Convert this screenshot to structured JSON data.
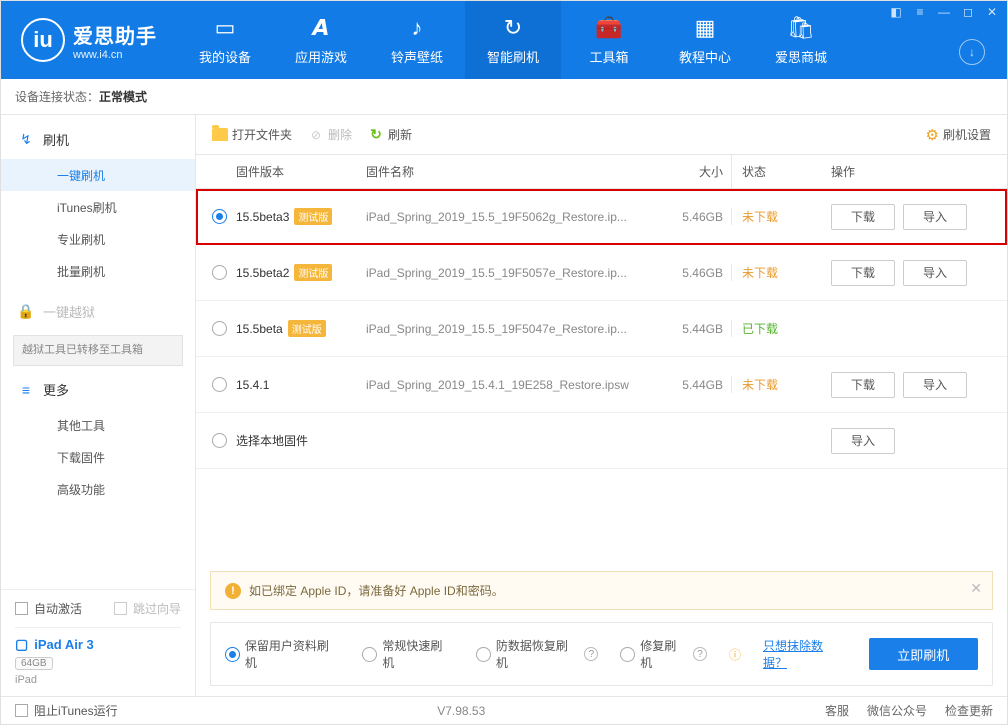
{
  "header": {
    "logo_title": "爱思助手",
    "logo_sub": "www.i4.cn",
    "nav": [
      {
        "label": "我的设备"
      },
      {
        "label": "应用游戏"
      },
      {
        "label": "铃声壁纸"
      },
      {
        "label": "智能刷机",
        "active": true
      },
      {
        "label": "工具箱"
      },
      {
        "label": "教程中心"
      },
      {
        "label": "爱思商城"
      }
    ]
  },
  "status_bar": {
    "prefix": "设备连接状态：",
    "mode": "正常模式"
  },
  "sidebar": {
    "groups": [
      {
        "icon": "flash",
        "title": "刷机",
        "items": [
          "一键刷机",
          "iTunes刷机",
          "专业刷机",
          "批量刷机"
        ],
        "active": 0
      },
      {
        "icon": "lock",
        "title": "一键越狱",
        "muted": true,
        "note": "越狱工具已转移至工具箱"
      },
      {
        "icon": "more",
        "title": "更多",
        "items": [
          "其他工具",
          "下载固件",
          "高级功能"
        ]
      }
    ],
    "auto_activate": "自动激活",
    "skip_guide": "跳过向导",
    "device": {
      "name": "iPad Air 3",
      "storage": "64GB",
      "type": "iPad"
    }
  },
  "toolbar": {
    "open_folder": "打开文件夹",
    "delete": "删除",
    "refresh": "刷新",
    "settings": "刷机设置"
  },
  "table": {
    "head": {
      "version": "固件版本",
      "name": "固件名称",
      "size": "大小",
      "status": "状态",
      "ops": "操作"
    },
    "beta_tag": "测试版",
    "download_btn": "下载",
    "import_btn": "导入",
    "status_labels": {
      "not_downloaded": "未下载",
      "downloaded": "已下载"
    },
    "rows": [
      {
        "selected": true,
        "highlight": true,
        "version": "15.5beta3",
        "beta": true,
        "name": "iPad_Spring_2019_15.5_19F5062g_Restore.ip...",
        "size": "5.46GB",
        "status": "not_downloaded",
        "ops": [
          "download",
          "import"
        ]
      },
      {
        "version": "15.5beta2",
        "beta": true,
        "name": "iPad_Spring_2019_15.5_19F5057e_Restore.ip...",
        "size": "5.46GB",
        "status": "not_downloaded",
        "ops": [
          "download",
          "import"
        ]
      },
      {
        "version": "15.5beta",
        "beta": true,
        "name": "iPad_Spring_2019_15.5_19F5047e_Restore.ip...",
        "size": "5.44GB",
        "status": "downloaded",
        "ops": []
      },
      {
        "version": "15.4.1",
        "beta": false,
        "name": "iPad_Spring_2019_15.4.1_19E258_Restore.ipsw",
        "size": "5.44GB",
        "status": "not_downloaded",
        "ops": [
          "download",
          "import"
        ]
      },
      {
        "version": "选择本地固件",
        "beta": false,
        "name": "",
        "size": "",
        "status": "",
        "ops": [
          "import"
        ],
        "local": true
      }
    ]
  },
  "notice": "如已绑定 Apple ID，请准备好 Apple ID和密码。",
  "flash_options": {
    "o1": "保留用户资料刷机",
    "o2": "常规快速刷机",
    "o3": "防数据恢复刷机",
    "o4": "修复刷机",
    "erase_link": "只想抹除数据？",
    "go": "立即刷机"
  },
  "footer": {
    "block_itunes": "阻止iTunes运行",
    "version": "V7.98.53",
    "links": [
      "客服",
      "微信公众号",
      "检查更新"
    ]
  }
}
